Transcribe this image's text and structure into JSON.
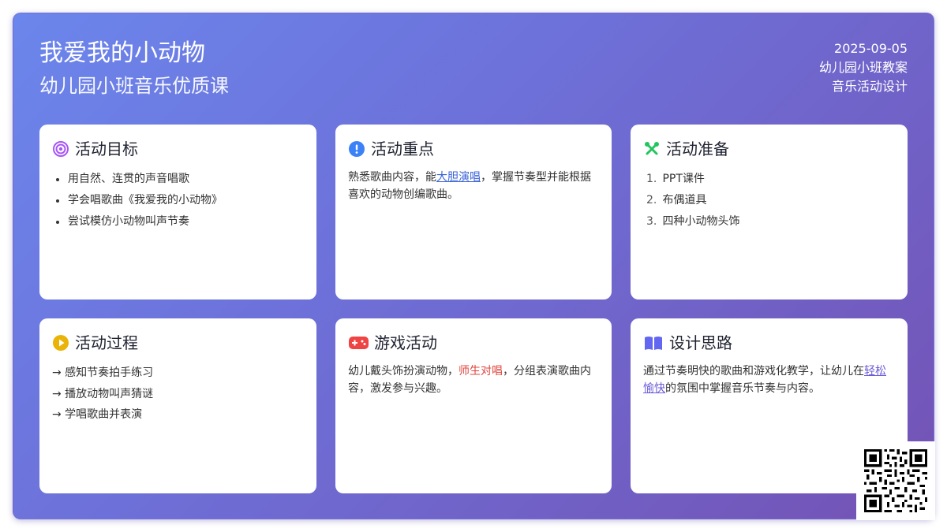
{
  "header": {
    "title": "我爱我的小动物",
    "subtitle": "幼儿园小班音乐优质课",
    "date": "2025-09-05",
    "meta_line1": "幼儿园小班教案",
    "meta_line2": "音乐活动设计"
  },
  "colors": {
    "gradient_start": "#6b86ec",
    "gradient_end": "#7452b4",
    "target_icon": "#a855f7",
    "key_icon": "#3b82f6",
    "prep_icon": "#22c55e",
    "process_icon": "#eab308",
    "game_icon": "#ef4444",
    "design_icon": "#6366f1"
  },
  "cards": {
    "goals": {
      "icon": "target-icon",
      "title": "活动目标",
      "items": [
        "用自然、连贯的声音唱歌",
        "学会唱歌曲《我爱我的小动物》",
        "尝试模仿小动物叫声节奏"
      ]
    },
    "key": {
      "icon": "exclamation-icon",
      "title": "活动重点",
      "text_before": "熟悉歌曲内容，能",
      "highlight": "大胆演唱",
      "text_after": "，掌握节奏型并能根据喜欢的动物创编歌曲。"
    },
    "prep": {
      "icon": "tools-icon",
      "title": "活动准备",
      "items": [
        {
          "num": "1.",
          "text": "PPT课件"
        },
        {
          "num": "2.",
          "text": "布偶道具"
        },
        {
          "num": "3.",
          "text": "四种小动物头饰"
        }
      ]
    },
    "process": {
      "icon": "play-icon",
      "title": "活动过程",
      "steps": [
        "→ 感知节奏拍手练习",
        "→ 播放动物叫声猜谜",
        "→ 学唱歌曲并表演"
      ]
    },
    "game": {
      "icon": "gamepad-icon",
      "title": "游戏活动",
      "text_before": "幼儿戴头饰扮演动物，",
      "highlight": "师生对唱",
      "text_after": "，分组表演歌曲内容，激发参与兴趣。"
    },
    "design": {
      "icon": "book-icon",
      "title": "设计思路",
      "text_before": "通过节奏明快的歌曲和游戏化教学，让幼儿在",
      "highlight": "轻松愉快",
      "text_after": "的氛围中掌握音乐节奏与内容。"
    }
  },
  "qr": {
    "icon": "qr-code-icon"
  }
}
